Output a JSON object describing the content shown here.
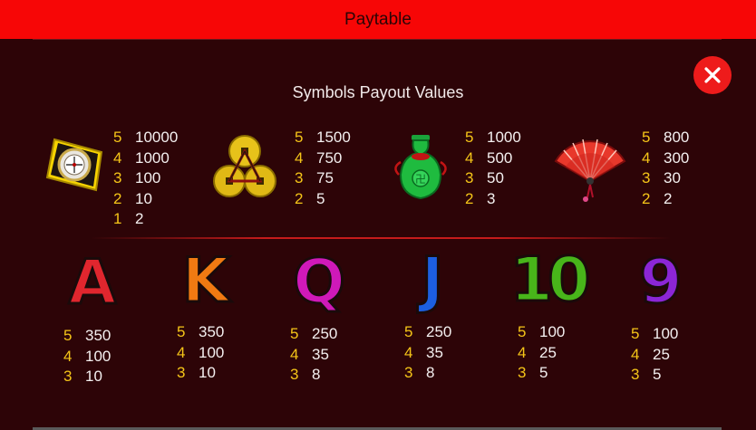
{
  "header": {
    "title": "Paytable"
  },
  "section": {
    "title": "Symbols Payout Values"
  },
  "colors": {
    "header_bg": "#f70606",
    "background": "#2d0407",
    "count": "#f5c518",
    "value": "#f4f0f0",
    "close_bg": "#ee1b1b"
  },
  "top_symbols": [
    {
      "icon": "compass-icon",
      "pays": [
        {
          "count": "5",
          "value": "10000"
        },
        {
          "count": "4",
          "value": "1000"
        },
        {
          "count": "3",
          "value": "100"
        },
        {
          "count": "2",
          "value": "10"
        },
        {
          "count": "1",
          "value": "2"
        }
      ]
    },
    {
      "icon": "coins-icon",
      "pays": [
        {
          "count": "5",
          "value": "1500"
        },
        {
          "count": "4",
          "value": "750"
        },
        {
          "count": "3",
          "value": "75"
        },
        {
          "count": "2",
          "value": "5"
        }
      ]
    },
    {
      "icon": "jade-vase-icon",
      "pays": [
        {
          "count": "5",
          "value": "1000"
        },
        {
          "count": "4",
          "value": "500"
        },
        {
          "count": "3",
          "value": "50"
        },
        {
          "count": "2",
          "value": "3"
        }
      ]
    },
    {
      "icon": "fan-icon",
      "pays": [
        {
          "count": "5",
          "value": "800"
        },
        {
          "count": "4",
          "value": "300"
        },
        {
          "count": "3",
          "value": "30"
        },
        {
          "count": "2",
          "value": "2"
        }
      ]
    }
  ],
  "low_symbols": [
    {
      "glyph": "A",
      "icon": "ace-icon",
      "pays": [
        {
          "count": "5",
          "value": "350"
        },
        {
          "count": "4",
          "value": "100"
        },
        {
          "count": "3",
          "value": "10"
        }
      ]
    },
    {
      "glyph": "K",
      "icon": "king-icon",
      "pays": [
        {
          "count": "5",
          "value": "350"
        },
        {
          "count": "4",
          "value": "100"
        },
        {
          "count": "3",
          "value": "10"
        }
      ]
    },
    {
      "glyph": "Q",
      "icon": "queen-icon",
      "pays": [
        {
          "count": "5",
          "value": "250"
        },
        {
          "count": "4",
          "value": "35"
        },
        {
          "count": "3",
          "value": "8"
        }
      ]
    },
    {
      "glyph": "J",
      "icon": "jack-icon",
      "pays": [
        {
          "count": "5",
          "value": "250"
        },
        {
          "count": "4",
          "value": "35"
        },
        {
          "count": "3",
          "value": "8"
        }
      ]
    },
    {
      "glyph": "10",
      "icon": "ten-icon",
      "pays": [
        {
          "count": "5",
          "value": "100"
        },
        {
          "count": "4",
          "value": "25"
        },
        {
          "count": "3",
          "value": "5"
        }
      ]
    },
    {
      "glyph": "9",
      "icon": "nine-icon",
      "pays": [
        {
          "count": "5",
          "value": "100"
        },
        {
          "count": "4",
          "value": "25"
        },
        {
          "count": "3",
          "value": "5"
        }
      ]
    }
  ]
}
